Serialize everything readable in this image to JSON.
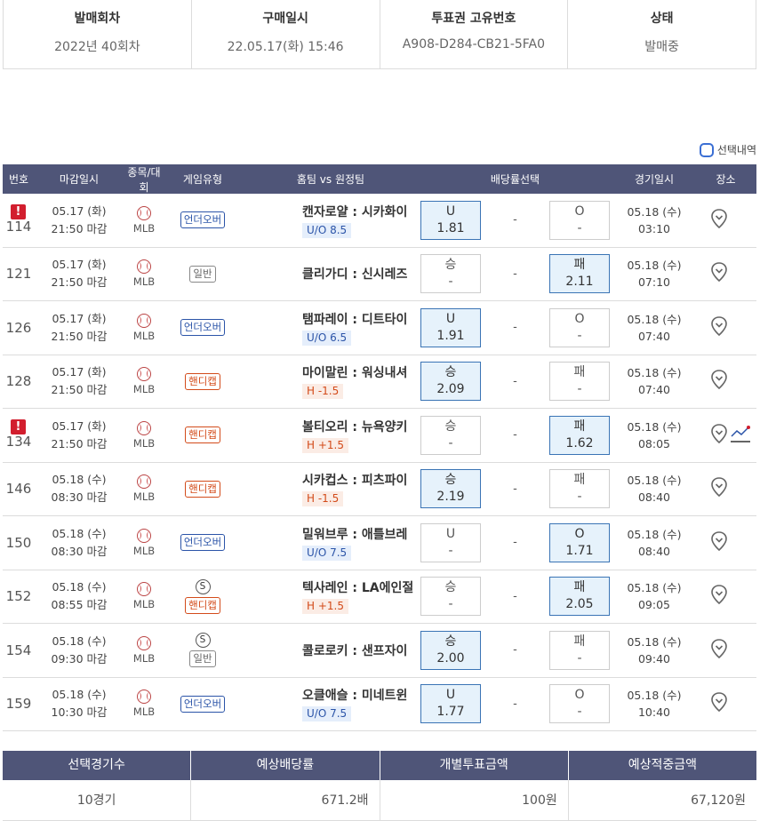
{
  "info": {
    "headers": [
      "발매회차",
      "구매일시",
      "투표권 고유번호",
      "상태"
    ],
    "values": [
      "2022년 40회차",
      "22.05.17(화) 15:46",
      "A908-D284-CB21-5FA0",
      "발매중"
    ]
  },
  "selection_toggle_label": "선택내역",
  "table": {
    "headers": [
      "번호",
      "마감일시",
      "종목/대회",
      "게임유형",
      "홈팀 vs 원정팀",
      "배당률선택",
      "경기일시",
      "장소"
    ],
    "rows": [
      {
        "alert": "!",
        "no": "114",
        "deadline": [
          "05.17 (화)",
          "21:50 마감"
        ],
        "league": "MLB",
        "type": "언더오버",
        "type_kind": "ou",
        "s": "",
        "teams": "캔자로얄 : 시카화이",
        "line": "U/O 8.5",
        "line_kind": "ou",
        "left": {
          "label": "U",
          "odds": "1.81",
          "on": true
        },
        "mid": "-",
        "right": {
          "label": "O",
          "odds": "-",
          "on": false
        },
        "date": [
          "05.18 (수)",
          "03:10"
        ],
        "chart": false
      },
      {
        "alert": "",
        "no": "121",
        "deadline": [
          "05.17 (화)",
          "21:50 마감"
        ],
        "league": "MLB",
        "type": "일반",
        "type_kind": "gen",
        "s": "",
        "teams": "클리가디 : 신시레즈",
        "line": "",
        "line_kind": "",
        "left": {
          "label": "승",
          "odds": "-",
          "on": false
        },
        "mid": "-",
        "right": {
          "label": "패",
          "odds": "2.11",
          "on": true
        },
        "date": [
          "05.18 (수)",
          "07:10"
        ],
        "chart": false
      },
      {
        "alert": "",
        "no": "126",
        "deadline": [
          "05.17 (화)",
          "21:50 마감"
        ],
        "league": "MLB",
        "type": "언더오버",
        "type_kind": "ou",
        "s": "",
        "teams": "탬파레이 : 디트타이",
        "line": "U/O 6.5",
        "line_kind": "ou",
        "left": {
          "label": "U",
          "odds": "1.91",
          "on": true
        },
        "mid": "-",
        "right": {
          "label": "O",
          "odds": "-",
          "on": false
        },
        "date": [
          "05.18 (수)",
          "07:40"
        ],
        "chart": false
      },
      {
        "alert": "",
        "no": "128",
        "deadline": [
          "05.17 (화)",
          "21:50 마감"
        ],
        "league": "MLB",
        "type": "핸디캡",
        "type_kind": "hc",
        "s": "",
        "teams": "마이말린 : 워싱내셔",
        "line": "H -1.5",
        "line_kind": "hc",
        "left": {
          "label": "승",
          "odds": "2.09",
          "on": true
        },
        "mid": "-",
        "right": {
          "label": "패",
          "odds": "-",
          "on": false
        },
        "date": [
          "05.18 (수)",
          "07:40"
        ],
        "chart": false
      },
      {
        "alert": "!",
        "no": "134",
        "deadline": [
          "05.17 (화)",
          "21:50 마감"
        ],
        "league": "MLB",
        "type": "핸디캡",
        "type_kind": "hc",
        "s": "",
        "teams": "볼티오리 : 뉴욕양키",
        "line": "H +1.5",
        "line_kind": "hc",
        "left": {
          "label": "승",
          "odds": "-",
          "on": false
        },
        "mid": "-",
        "right": {
          "label": "패",
          "odds": "1.62",
          "on": true
        },
        "date": [
          "05.18 (수)",
          "08:05"
        ],
        "chart": true
      },
      {
        "alert": "",
        "no": "146",
        "deadline": [
          "05.18 (수)",
          "08:30 마감"
        ],
        "league": "MLB",
        "type": "핸디캡",
        "type_kind": "hc",
        "s": "",
        "teams": "시카컵스 : 피츠파이",
        "line": "H -1.5",
        "line_kind": "hc",
        "left": {
          "label": "승",
          "odds": "2.19",
          "on": true
        },
        "mid": "-",
        "right": {
          "label": "패",
          "odds": "-",
          "on": false
        },
        "date": [
          "05.18 (수)",
          "08:40"
        ],
        "chart": false
      },
      {
        "alert": "",
        "no": "150",
        "deadline": [
          "05.18 (수)",
          "08:30 마감"
        ],
        "league": "MLB",
        "type": "언더오버",
        "type_kind": "ou",
        "s": "",
        "teams": "밀워브루 : 애틀브레",
        "line": "U/O 7.5",
        "line_kind": "ou",
        "left": {
          "label": "U",
          "odds": "-",
          "on": false
        },
        "mid": "-",
        "right": {
          "label": "O",
          "odds": "1.71",
          "on": true
        },
        "date": [
          "05.18 (수)",
          "08:40"
        ],
        "chart": false
      },
      {
        "alert": "",
        "no": "152",
        "deadline": [
          "05.18 (수)",
          "08:55 마감"
        ],
        "league": "MLB",
        "type": "핸디캡",
        "type_kind": "hc",
        "s": "S",
        "teams": "텍사레인 : LA에인절",
        "line": "H +1.5",
        "line_kind": "hc",
        "left": {
          "label": "승",
          "odds": "-",
          "on": false
        },
        "mid": "-",
        "right": {
          "label": "패",
          "odds": "2.05",
          "on": true
        },
        "date": [
          "05.18 (수)",
          "09:05"
        ],
        "chart": false
      },
      {
        "alert": "",
        "no": "154",
        "deadline": [
          "05.18 (수)",
          "09:30 마감"
        ],
        "league": "MLB",
        "type": "일반",
        "type_kind": "gen",
        "s": "S",
        "teams": "콜로로키 : 샌프자이",
        "line": "",
        "line_kind": "",
        "left": {
          "label": "승",
          "odds": "2.00",
          "on": true
        },
        "mid": "-",
        "right": {
          "label": "패",
          "odds": "-",
          "on": false
        },
        "date": [
          "05.18 (수)",
          "09:40"
        ],
        "chart": false
      },
      {
        "alert": "",
        "no": "159",
        "deadline": [
          "05.18 (수)",
          "10:30 마감"
        ],
        "league": "MLB",
        "type": "언더오버",
        "type_kind": "ou",
        "s": "",
        "teams": "오클애슬 : 미네트윈",
        "line": "U/O 7.5",
        "line_kind": "ou",
        "left": {
          "label": "U",
          "odds": "1.77",
          "on": true
        },
        "mid": "-",
        "right": {
          "label": "O",
          "odds": "-",
          "on": false
        },
        "date": [
          "05.18 (수)",
          "10:40"
        ],
        "chart": false
      }
    ]
  },
  "summary": {
    "headers": [
      "선택경기수",
      "예상배당률",
      "개별투표금액",
      "예상적중금액"
    ],
    "values": [
      "10경기",
      "671.2배",
      "100원",
      "67,120원"
    ]
  },
  "colors": {
    "header_bg": "#4f5578",
    "selected_bg": "#e6f2fb",
    "alert": "#d21e2e",
    "ou": "#2b54a8",
    "handicap": "#d34b1a"
  },
  "icons": {
    "place": "map-pin-icon",
    "sport": "baseball-icon",
    "chart": "trend-chart-icon"
  }
}
